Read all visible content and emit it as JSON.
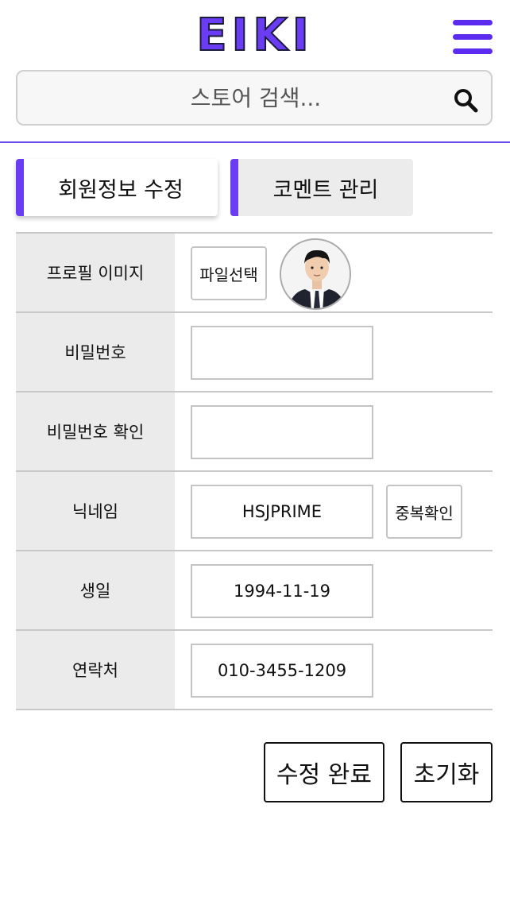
{
  "header": {
    "logo": "EIKI",
    "brand_color": "#6a3cf4",
    "menu_icon": "hamburger-menu-icon"
  },
  "search": {
    "placeholder": "스토어 검색...",
    "value": "",
    "icon": "search-icon"
  },
  "tabs": [
    {
      "label": "회원정보 수정",
      "active": true
    },
    {
      "label": "코멘트 관리",
      "active": false
    }
  ],
  "form": {
    "profile": {
      "label": "프로필 이미지",
      "button": "파일선택",
      "avatar": "profile-avatar"
    },
    "password": {
      "label": "비밀번호",
      "value": ""
    },
    "password_confirm": {
      "label": "비밀번호 확인",
      "value": ""
    },
    "nickname": {
      "label": "닉네임",
      "value": "HSJPRIME",
      "button": "중복확인"
    },
    "birthday": {
      "label": "생일",
      "value": "1994-11-19"
    },
    "phone": {
      "label": "연락처",
      "value": "010-3455-1209"
    }
  },
  "actions": {
    "submit": "수정 완료",
    "reset": "초기화"
  }
}
